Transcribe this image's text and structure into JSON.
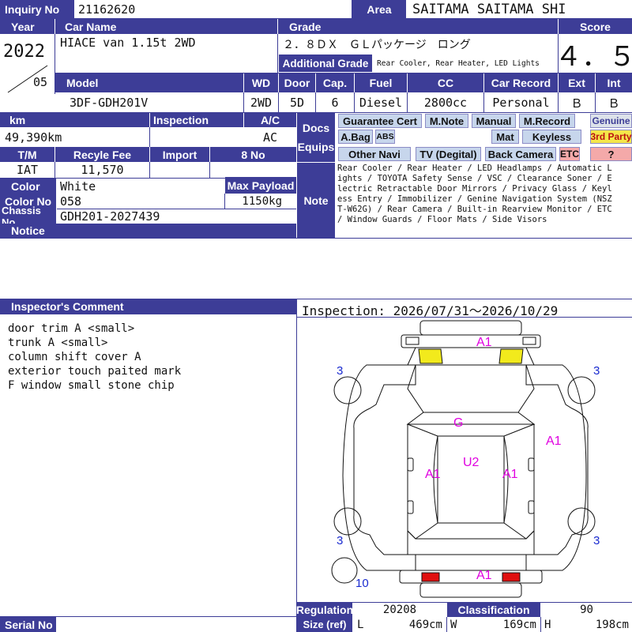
{
  "inquiry": {
    "label": "Inquiry No",
    "value": "21162620"
  },
  "area": {
    "label": "Area",
    "value": "SAITAMA SAITAMA SHI"
  },
  "headers": {
    "year": "Year",
    "car_name": "Car Name",
    "grade": "Grade",
    "score": "Score",
    "model": "Model",
    "wd": "WD",
    "door": "Door",
    "cap": "Cap.",
    "fuel": "Fuel",
    "cc": "CC",
    "car_record": "Car Record",
    "ext": "Ext",
    "int": "Int",
    "km": "km",
    "inspection": "Inspection",
    "ac": "A/C",
    "docs": "Docs",
    "equips": "Equips",
    "tm": "T/M",
    "recycle_fee": "Recyle Fee",
    "import": "Import",
    "no8": "8 No",
    "color": "Color",
    "max_payload": "Max Payload",
    "color_no": "Color No",
    "chassis_no": "Chassis No",
    "notice": "Notice",
    "note": "Note",
    "additional_grade": "Additional Grade",
    "inspector_comment": "Inspector's Comment",
    "regulation": "Regulation",
    "classification": "Classification",
    "size_ref": "Size (ref)",
    "serial_no": "Serial No"
  },
  "vehicle": {
    "year": "2022",
    "month": "05",
    "car_name": "HIACE van 1.15t 2WD",
    "grade": "２．８ＤＸ　ＧＬパッケージ　ロング",
    "additional_grade": "Rear Cooler, Rear Heater, LED Lights",
    "score": "４．５",
    "model": "3DF-GDH201V",
    "wd": "2WD",
    "door": "5D",
    "cap": "6",
    "fuel": "Diesel",
    "cc": "2800cc",
    "car_record": "Personal",
    "ext": "Ｂ",
    "int": "Ｂ",
    "km": "49,390km",
    "inspection": "",
    "ac": "AC",
    "tm": "IAT",
    "recycle_fee": "11,570",
    "import": "",
    "no8": "",
    "color": "White",
    "max_payload": "1150kg",
    "color_no": "058",
    "chassis_no": "GDH201-2027439"
  },
  "equips": {
    "guarantee_cert": "Guarantee Cert",
    "m_note": "M.Note",
    "manual": "Manual",
    "m_record": "M.Record",
    "genuine": "Genuine",
    "a_bag": "A.Bag",
    "abs": "ABS",
    "mat": "Mat",
    "keyless": "Keyless",
    "third_party": "3rd Party",
    "other_navi": "Other Navi",
    "tv": "TV (Degital)",
    "back_camera": "Back Camera",
    "etc": "ETC",
    "question": "?"
  },
  "note_text": "Rear Cooler / Rear Heater / LED Headlamps / Automatic Lights / TOYOTA Safety Sense / VSC / Clearance Soner / Electric Retractable Door Mirrors / Privacy Glass / Keyless Entry / Immobilizer / Genine Navigation System (NSZT-W62G) / Rear Camera / Built-in Rearview Monitor / ETC / Window Guards / Floor Mats / Side Visors",
  "comments": [
    "door trim A <small>",
    "trunk A <small>",
    "column shift cover A",
    "exterior touch paited mark",
    "F window small stone chip"
  ],
  "inspection_period": "Inspection: 2026/07/31～2026/10/29",
  "diagram_marks": {
    "front": "A1",
    "hood": "G",
    "roof": "U2",
    "left_side": "A1",
    "right_side": "A1",
    "right_door": "A1",
    "rear": "A1",
    "tire_fl": "3",
    "tire_fr": "3",
    "tire_rl": "3",
    "tire_rr": "3",
    "spare": "10"
  },
  "footer": {
    "regulation": "20208",
    "classification": "90",
    "l_label": "L",
    "l_value": "469cm",
    "w_label": "W",
    "w_value": "169cm",
    "h_label": "H",
    "h_value": "198cm"
  },
  "colors": {
    "header_bg": "#3d3d97",
    "marker": "#e000e0",
    "tire_num": "#1a2bd0",
    "yellow_mark": "#f2ea1c",
    "red_mark": "#e01010"
  }
}
